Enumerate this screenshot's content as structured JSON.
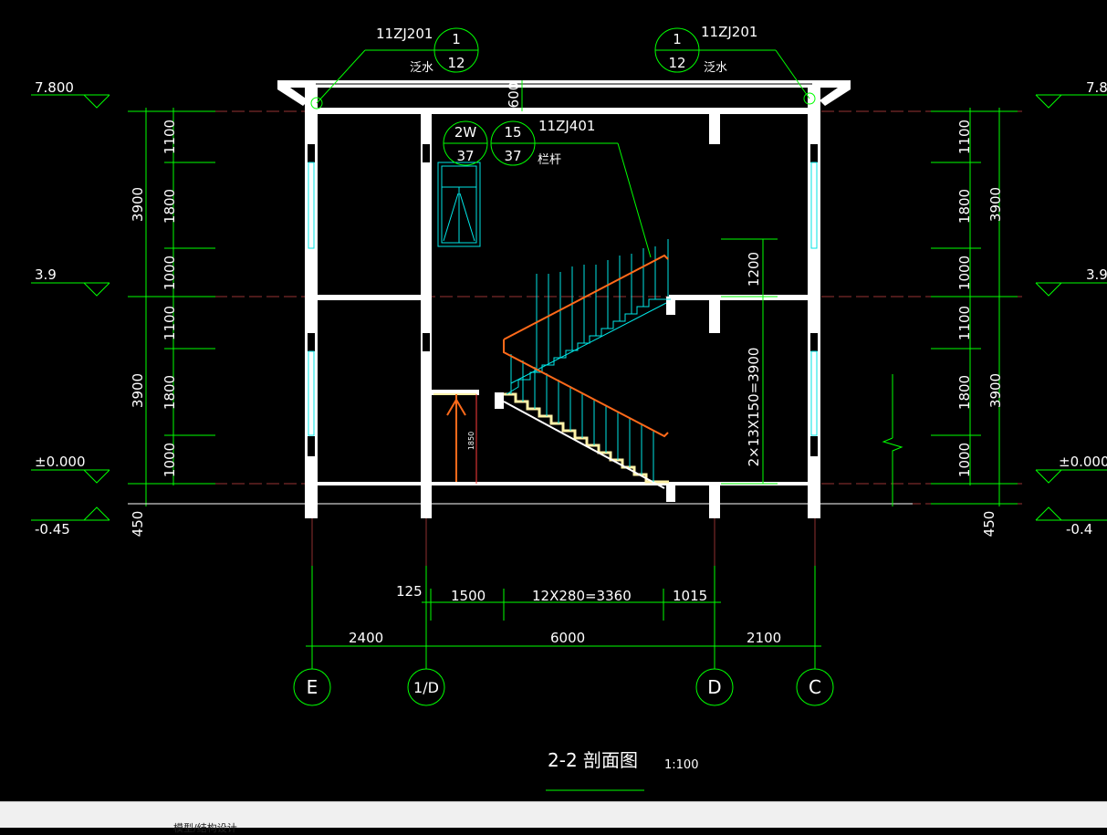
{
  "drawing": {
    "title": "2-2 剖面图",
    "scale": "1:100",
    "levels": {
      "roof": "7.800",
      "floor2": "3.9",
      "ground": "±0.000",
      "outdoor": "-0.45",
      "roof_right": "7.8",
      "floor2_right": "3.9",
      "ground_right": "±0.000",
      "outdoor_right": "-0.4"
    },
    "vertical_dims": {
      "d1100": "1100",
      "d1800": "1800",
      "d1000": "1000",
      "d3900": "3900",
      "d450": "450",
      "d1200": "1200",
      "stair_height": "2×13X150=3900",
      "parapet": "600",
      "step_mark": "1850"
    },
    "horizontal_dims": {
      "d125": "125",
      "d1500": "1500",
      "d3360": "12X280=3360",
      "d1015": "1015",
      "d2400": "2400",
      "d6000": "6000",
      "d2100": "2100"
    },
    "axes": [
      "E",
      "1/D",
      "D",
      "C"
    ],
    "callouts": {
      "left": {
        "ref": "11ZJ201",
        "num": "1",
        "sheet": "12",
        "note": "泛水"
      },
      "right": {
        "ref": "11ZJ201",
        "num": "1",
        "sheet": "12",
        "note": "泛水"
      },
      "rail_a": {
        "num": "2W",
        "sheet": "37"
      },
      "rail_b": {
        "num": "15",
        "sheet": "37",
        "ref": "11ZJ401",
        "note": "栏杆"
      }
    }
  },
  "status_bar": {
    "text": "模型/结构设计"
  },
  "colors": {
    "background": "#000000",
    "dimension": "#00ff00",
    "walls": "#ffffff",
    "railing": "#ff6a1a",
    "windows": "#00e5e5"
  }
}
